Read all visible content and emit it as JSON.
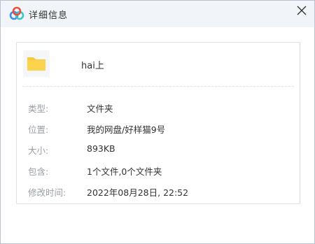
{
  "window": {
    "title": "详细信息",
    "close_icon": "close-icon",
    "logo_icon": "baidu-netdisk-logo-icon",
    "accent_colors": [
      "#e94e3f",
      "#3b8ef0",
      "#38c7c2"
    ]
  },
  "file": {
    "name": "hai上",
    "icon": "folder-icon",
    "icon_color": "#f8c73a"
  },
  "info": {
    "type_label": "类型:",
    "type_value": "文件夹",
    "location_label": "位置:",
    "location_value": "我的网盘/好样猫9号",
    "size_label": "大小:",
    "size_value": "893KB",
    "contains_label": "包含:",
    "contains_value": "1个文件,0个文件夹",
    "modified_label": "修改时间:",
    "modified_value": "2022年08月28日, 22:52"
  }
}
